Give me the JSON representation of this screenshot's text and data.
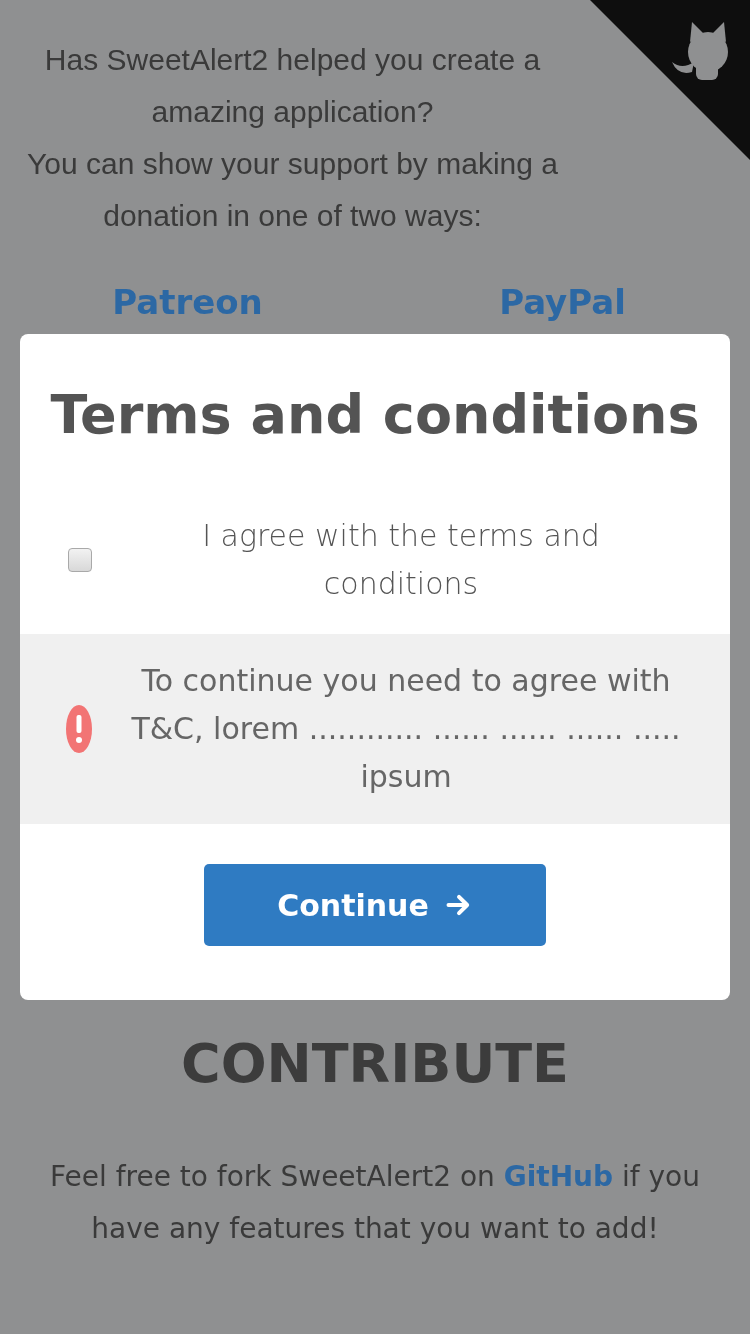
{
  "page": {
    "intro_lines": [
      "Has SweetAlert2 helped you create a",
      "amazing application?",
      "You can show your support by making a",
      "donation in one of two ways:"
    ],
    "donation_links": [
      "Patreon",
      "PayPal"
    ],
    "contribute_heading": "CONTRIBUTE",
    "contribute_text": {
      "before": "Feel free to fork SweetAlert2 on",
      "link": "GitHub",
      "after": "if you have any features that you want to add!"
    }
  },
  "modal": {
    "title": "Terms and conditions",
    "checkbox": {
      "label": "I agree with the terms and conditions",
      "checked": false
    },
    "validation_message": "To continue you need to agree with T&C, lorem ............ ...... ...... ...... ..... ipsum",
    "button": "Continue"
  }
}
